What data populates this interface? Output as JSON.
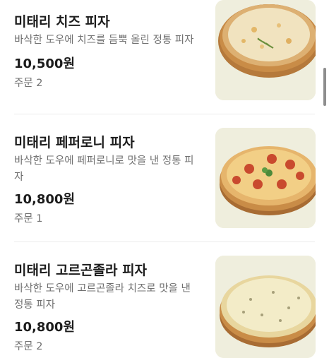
{
  "menu": {
    "items": [
      {
        "name": "미태리 치즈 피자",
        "description_lines": [
          "바삭한 도우에 치즈를 듬뿍 올린 정통 피자"
        ],
        "price": "10,500원",
        "orders": "주문 2",
        "image": "cheese-pizza-image"
      },
      {
        "name": "미태리 페퍼로니 피자",
        "description_lines": [
          "바삭한 도우에 페퍼로니로 맛을 낸 정통 피",
          "자"
        ],
        "price": "10,800원",
        "orders": "주문 1",
        "image": "pepperoni-pizza-image"
      },
      {
        "name": "미태리 고르곤졸라 피자",
        "description_lines": [
          "바삭한 도우에 고르곤졸라 치즈로 맛을 낸",
          "정통 피자"
        ],
        "price": "10,800원",
        "orders": "주문 2",
        "image": "gorgonzola-pizza-image"
      }
    ]
  },
  "colors": {
    "thumb_background": "#efeedd",
    "text_primary": "#1c1c1c",
    "text_secondary": "#707070"
  }
}
